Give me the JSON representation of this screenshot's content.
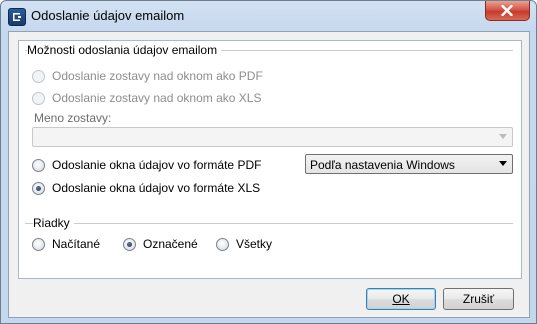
{
  "window": {
    "title": "Odoslanie údajov emailom"
  },
  "icons": {
    "app": "app-logo-icon",
    "close": "close-icon",
    "dropdown": "chevron-down-icon"
  },
  "options_group": {
    "title": "Možnosti odoslania údajov emailom",
    "radios": [
      {
        "label": "Odoslanie zostavy nad oknom ako PDF",
        "checked": false,
        "enabled": false
      },
      {
        "label": "Odoslanie zostavy nad oknom ako XLS",
        "checked": false,
        "enabled": false
      },
      {
        "label": "Odoslanie okna údajov vo formáte PDF",
        "checked": false,
        "enabled": true
      },
      {
        "label": "Odoslanie okna údajov vo formáte XLS",
        "checked": true,
        "enabled": true
      }
    ],
    "report_name_label": "Meno zostavy:",
    "report_name_value": "",
    "pdf_format_select": {
      "selected": "Podľa nastavenia Windows"
    }
  },
  "rows_group": {
    "title": "Riadky",
    "radios": [
      {
        "label": "Načítané",
        "checked": false
      },
      {
        "label": "Označené",
        "checked": true
      },
      {
        "label": "Všetky",
        "checked": false
      }
    ]
  },
  "buttons": {
    "ok_label": "OK",
    "cancel_label": "Zrušiť"
  },
  "colors": {
    "titlebar": "#c6d8ee",
    "close_button": "#c43b2c",
    "default_button_border": "#3c7fb1"
  }
}
